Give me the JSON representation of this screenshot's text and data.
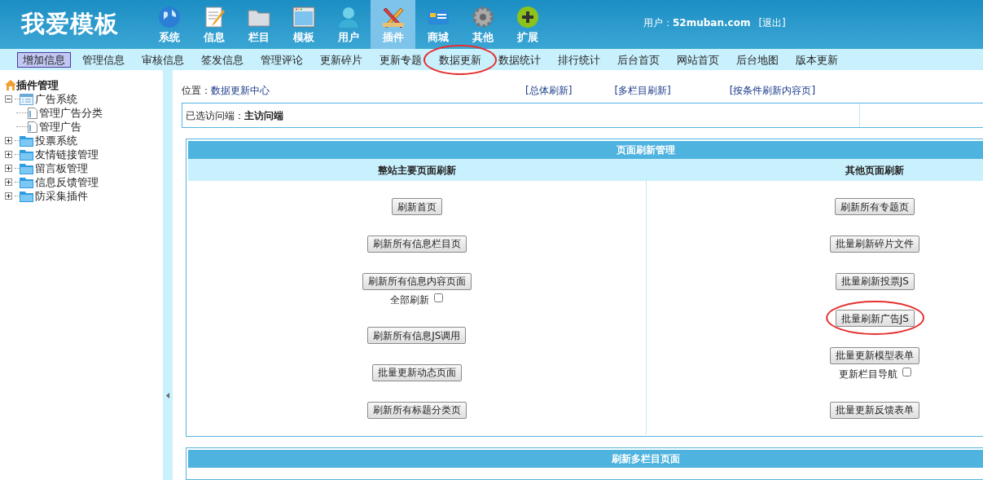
{
  "logo": "我爱模板",
  "nav": [
    {
      "label": "系统",
      "selected": false
    },
    {
      "label": "信息",
      "selected": false
    },
    {
      "label": "栏目",
      "selected": false
    },
    {
      "label": "模板",
      "selected": false
    },
    {
      "label": "用户",
      "selected": false
    },
    {
      "label": "插件",
      "selected": true
    },
    {
      "label": "商城",
      "selected": false
    },
    {
      "label": "其他",
      "selected": false
    },
    {
      "label": "扩展",
      "selected": false
    }
  ],
  "user": {
    "label": "用户：",
    "name": "52muban.com",
    "logout": "[退出]"
  },
  "subnav": [
    {
      "label": "增加信息",
      "selected": true,
      "highlighted": false
    },
    {
      "label": "管理信息",
      "selected": false,
      "highlighted": false
    },
    {
      "label": "审核信息",
      "selected": false,
      "highlighted": false
    },
    {
      "label": "签发信息",
      "selected": false,
      "highlighted": false
    },
    {
      "label": "管理评论",
      "selected": false,
      "highlighted": false
    },
    {
      "label": "更新碎片",
      "selected": false,
      "highlighted": false
    },
    {
      "label": "更新专题",
      "selected": false,
      "highlighted": false
    },
    {
      "label": "数据更新",
      "selected": false,
      "highlighted": true
    },
    {
      "label": "数据统计",
      "selected": false,
      "highlighted": false
    },
    {
      "label": "排行统计",
      "selected": false,
      "highlighted": false
    },
    {
      "label": "后台首页",
      "selected": false,
      "highlighted": false
    },
    {
      "label": "网站首页",
      "selected": false,
      "highlighted": false
    },
    {
      "label": "后台地图",
      "selected": false,
      "highlighted": false
    },
    {
      "label": "版本更新",
      "selected": false,
      "highlighted": false
    }
  ],
  "sidebar": {
    "title": "插件管理",
    "tree": [
      {
        "label": "广告系统",
        "expanded": true,
        "children": [
          {
            "label": "管理广告分类"
          },
          {
            "label": "管理广告"
          }
        ]
      },
      {
        "label": "投票系统",
        "expanded": false
      },
      {
        "label": "友情链接管理",
        "expanded": false
      },
      {
        "label": "留言板管理",
        "expanded": false
      },
      {
        "label": "信息反馈管理",
        "expanded": false
      },
      {
        "label": "防采集插件",
        "expanded": false
      }
    ]
  },
  "breadcrumb": {
    "label": "位置：",
    "link": "数据更新中心"
  },
  "top_links": [
    "[总体刷新]",
    "[多栏目刷新]",
    "[按条件刷新内容页]"
  ],
  "client": {
    "label": "已选访问端：",
    "value": "主访问端"
  },
  "refresh_panel": {
    "title": "页面刷新管理",
    "columns": [
      {
        "heading": "整站主要页面刷新",
        "items": [
          {
            "button": "刷新首页",
            "highlighted": false
          },
          {
            "button": "刷新所有信息栏目页",
            "highlighted": false
          },
          {
            "button": "刷新所有信息内容页面",
            "highlighted": false,
            "option": "全部刷新",
            "checked": false
          },
          {
            "button": "刷新所有信息JS调用",
            "highlighted": false
          },
          {
            "button": "批量更新动态页面",
            "highlighted": false
          },
          {
            "button": "刷新所有标题分类页",
            "highlighted": false
          }
        ]
      },
      {
        "heading": "其他页面刷新",
        "items": [
          {
            "button": "刷新所有专题页",
            "highlighted": false
          },
          {
            "button": "批量刷新碎片文件",
            "highlighted": false
          },
          {
            "button": "批量刷新投票JS",
            "highlighted": false
          },
          {
            "button": "批量刷新广告JS",
            "highlighted": true
          },
          {
            "button": "批量更新模型表单",
            "highlighted": false,
            "option": "更新栏目导航",
            "checked": false
          },
          {
            "button": "批量更新反馈表单",
            "highlighted": false
          }
        ]
      }
    ]
  },
  "multi_panel": {
    "title": "刷新多栏目页面"
  }
}
